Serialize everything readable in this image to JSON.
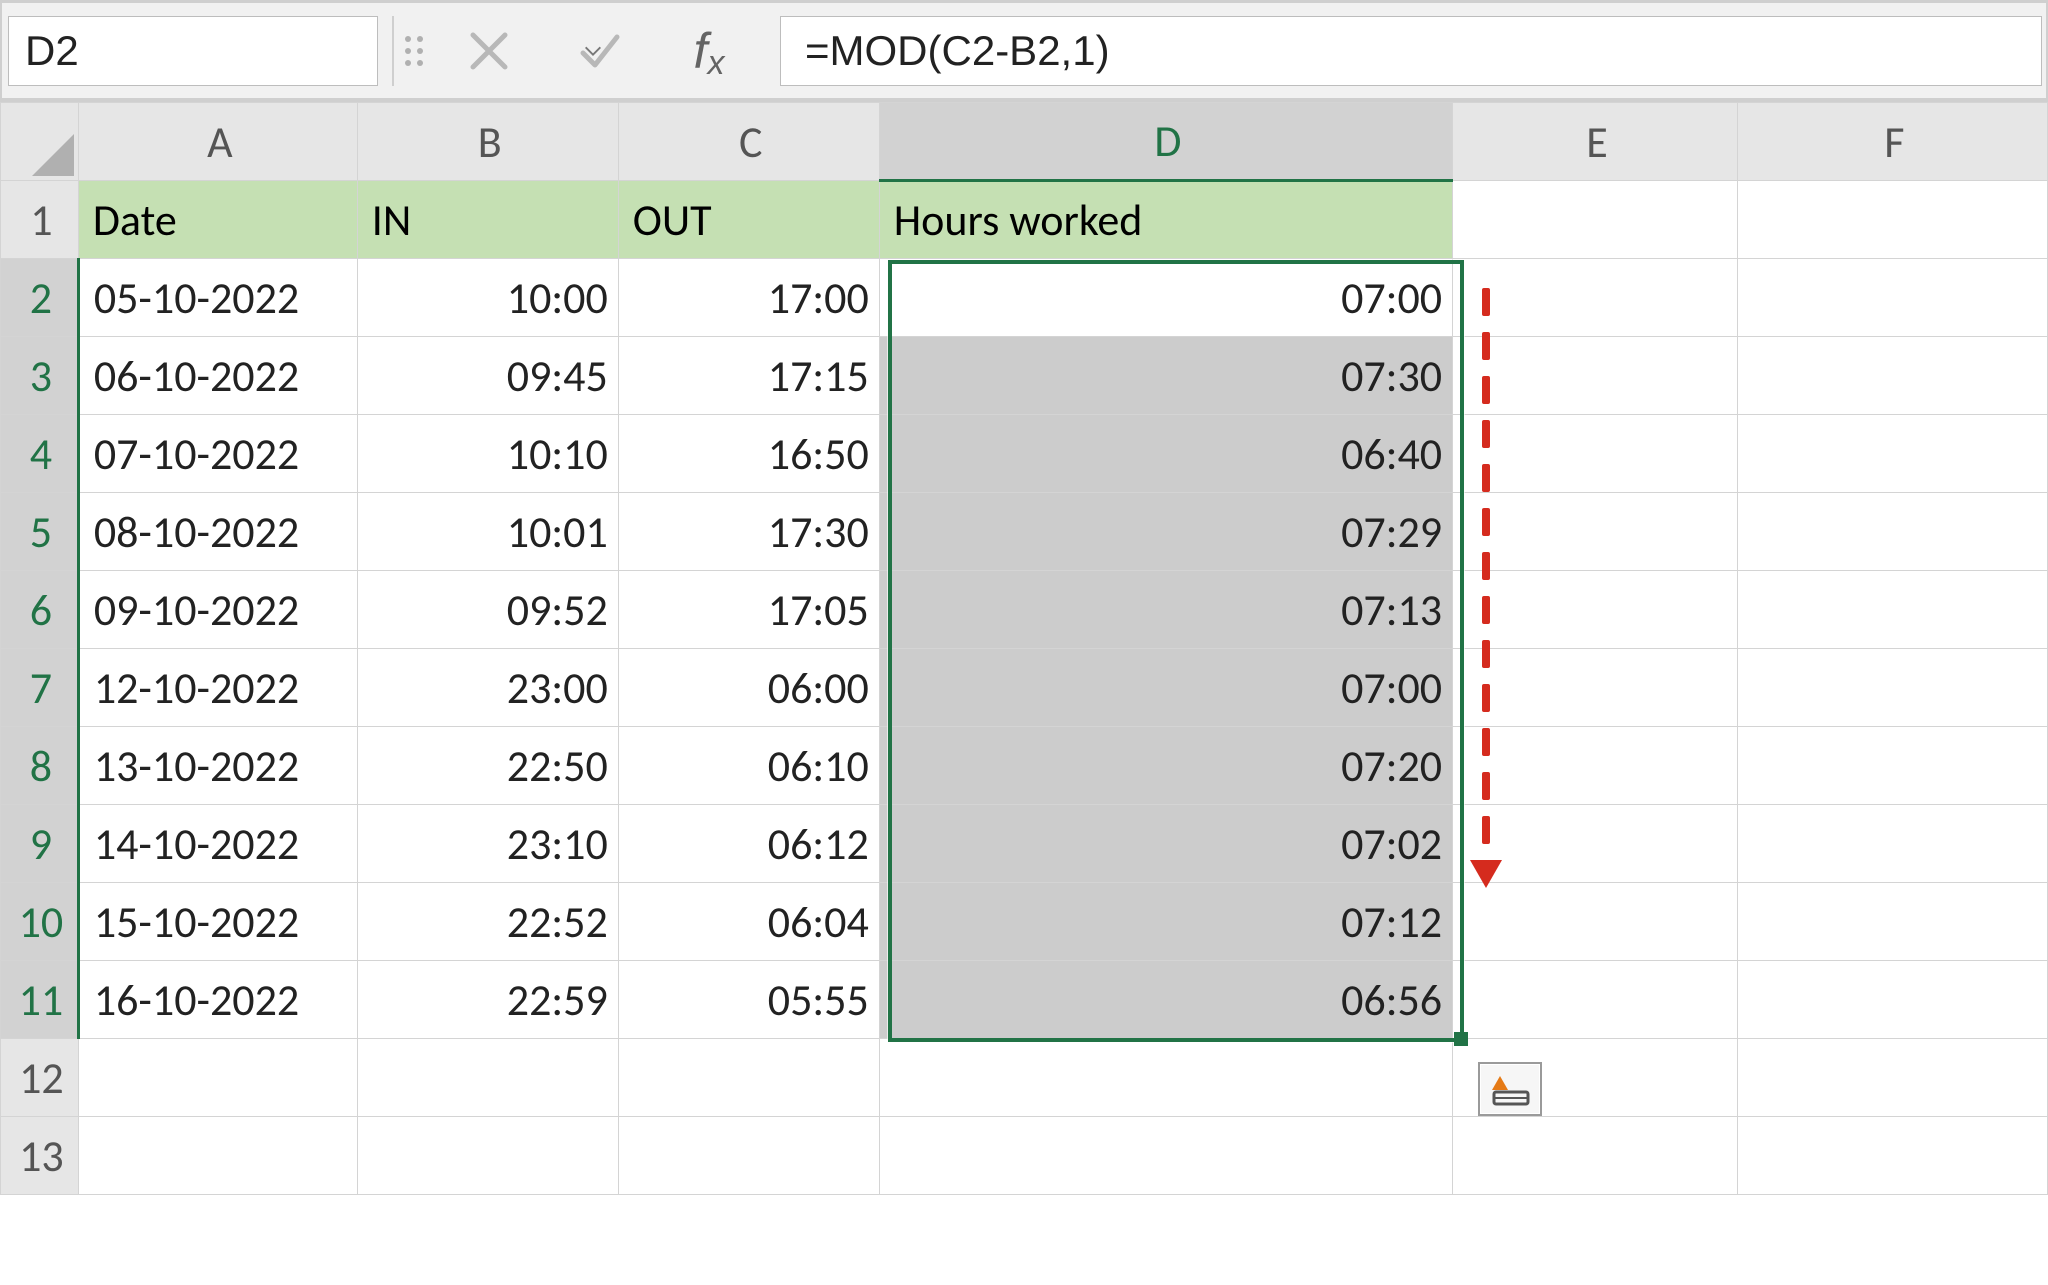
{
  "name_box": {
    "value": "D2"
  },
  "formula_bar": {
    "value": "=MOD(C2-B2,1)"
  },
  "columns": {
    "A": "A",
    "B": "B",
    "C": "C",
    "D": "D",
    "E": "E",
    "F": "F"
  },
  "row_numbers": [
    "1",
    "2",
    "3",
    "4",
    "5",
    "6",
    "7",
    "8",
    "9",
    "10",
    "11",
    "12",
    "13"
  ],
  "headers": {
    "A": "Date",
    "B": "IN",
    "C": "OUT",
    "D": "Hours worked"
  },
  "rows": [
    {
      "date": "05-10-2022",
      "in": "10:00",
      "out": "17:00",
      "hours": "07:00"
    },
    {
      "date": "06-10-2022",
      "in": "09:45",
      "out": "17:15",
      "hours": "07:30"
    },
    {
      "date": "07-10-2022",
      "in": "10:10",
      "out": "16:50",
      "hours": "06:40"
    },
    {
      "date": "08-10-2022",
      "in": "10:01",
      "out": "17:30",
      "hours": "07:29"
    },
    {
      "date": "09-10-2022",
      "in": "09:52",
      "out": "17:05",
      "hours": "07:13"
    },
    {
      "date": "12-10-2022",
      "in": "23:00",
      "out": "06:00",
      "hours": "07:00"
    },
    {
      "date": "13-10-2022",
      "in": "22:50",
      "out": "06:10",
      "hours": "07:20"
    },
    {
      "date": "14-10-2022",
      "in": "23:10",
      "out": "06:12",
      "hours": "07:02"
    },
    {
      "date": "15-10-2022",
      "in": "22:52",
      "out": "06:04",
      "hours": "07:12"
    },
    {
      "date": "16-10-2022",
      "in": "22:59",
      "out": "05:55",
      "hours": "06:56"
    }
  ],
  "icons": {
    "dropdown": "chevron-down-icon",
    "cancel": "cancel-icon",
    "enter": "check-icon",
    "fx": "fx-icon",
    "autofill_options": "autofill-options-icon"
  },
  "selection": {
    "range": "D2:D11",
    "active": "D2"
  }
}
